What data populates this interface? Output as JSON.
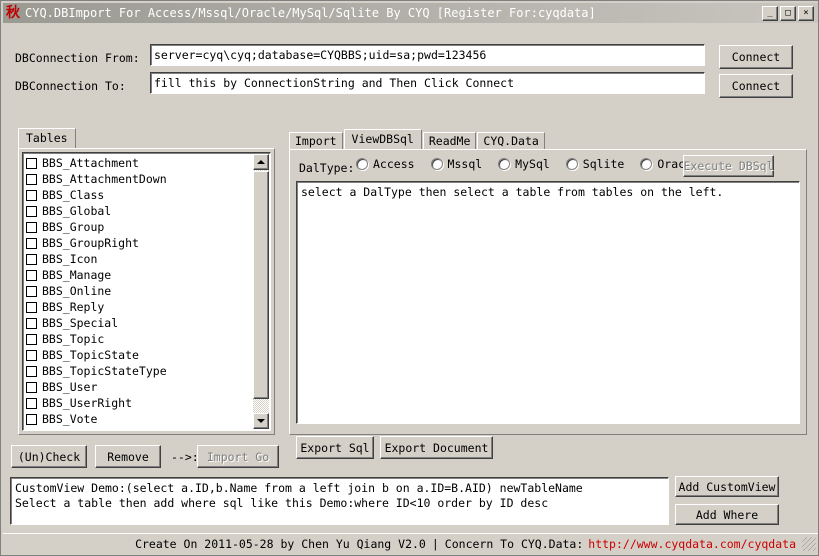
{
  "window": {
    "title": "CYQ.DBImport For Access/Mssql/Oracle/MySql/Sqlite By CYQ [Register For:cyqdata]",
    "icon_glyph": "秋",
    "minimize": "_",
    "maximize": "□",
    "close": "×"
  },
  "connection": {
    "from_label": "DBConnection From:",
    "from_value": "server=cyq\\cyq;database=CYQBBS;uid=sa;pwd=123456",
    "to_label": "DBConnection To:",
    "to_value": "fill this by ConnectionString and Then Click Connect",
    "connect_from_label": "Connect",
    "connect_to_label": "Connect"
  },
  "tables_panel": {
    "tab_label": "Tables",
    "items": [
      "BBS_Attachment",
      "BBS_AttachmentDown",
      "BBS_Class",
      "BBS_Global",
      "BBS_Group",
      "BBS_GroupRight",
      "BBS_Icon",
      "BBS_Manage",
      "BBS_Online",
      "BBS_Reply",
      "BBS_Special",
      "BBS_Topic",
      "BBS_TopicState",
      "BBS_TopicStateType",
      "BBS_User",
      "BBS_UserRight",
      "BBS_Vote"
    ],
    "uncheck_label": "(Un)Check",
    "remove_label": "Remove",
    "arrow_label": "-->:",
    "import_go_label": "Import Go"
  },
  "right_panel": {
    "tabs": [
      {
        "label": "Import",
        "active": false
      },
      {
        "label": "ViewDBSql",
        "active": true
      },
      {
        "label": "ReadMe",
        "active": false
      },
      {
        "label": "CYQ.Data",
        "active": false
      }
    ],
    "daltype_label": "DalType:",
    "daltype_options": [
      {
        "label": "Access",
        "selected": false
      },
      {
        "label": "Mssql",
        "selected": false
      },
      {
        "label": "MySql",
        "selected": false
      },
      {
        "label": "Sqlite",
        "selected": false
      },
      {
        "label": "Oracle",
        "selected": false
      }
    ],
    "execute_label": "Execute DBSql",
    "sql_text": "select a DalType then select a table from tables on the left.",
    "export_sql_label": "Export Sql",
    "export_document_label": "Export Document"
  },
  "bottom": {
    "custom_view_text": "CustomView Demo:(select a.ID,b.Name from a left join b on a.ID=B.AID) newTableName\nSelect a table then add where sql like this Demo:where ID<10 order by ID desc",
    "add_customview_label": "Add CustomView",
    "add_where_label": "Add Where"
  },
  "statusbar": {
    "created": "Create On 2011-05-28 by Chen Yu Qiang V2.0",
    "separator": "|",
    "concern": "Concern To CYQ.Data:",
    "link": "http://www.cyqdata.com/cyqdata"
  },
  "colors": {
    "face": "#d4d0c8",
    "link": "#cc0000",
    "title_text": "#ffffff"
  }
}
